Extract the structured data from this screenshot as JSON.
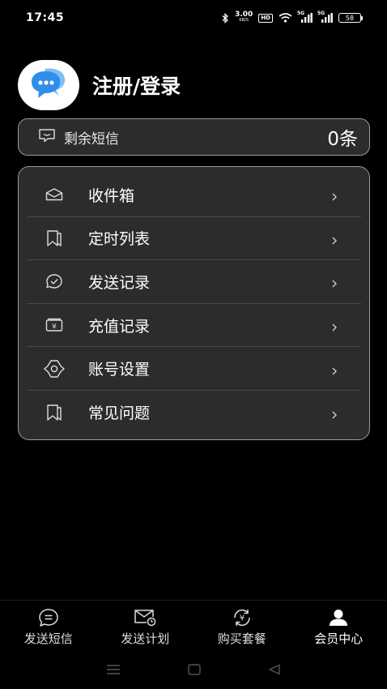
{
  "status_bar": {
    "time": "17:45",
    "net_speed_value": "3.00",
    "net_speed_unit": "KB/S",
    "hd_label": "HD",
    "sim1_tag": "5G",
    "sim2_tag": "5G",
    "battery_level": "58"
  },
  "profile": {
    "name": "注册/登录",
    "avatar_icon": "chat-bubbles-icon"
  },
  "balance": {
    "label": "剩余短信",
    "value": "0条",
    "icon": "message-icon"
  },
  "menu": {
    "items": [
      {
        "label": "收件箱",
        "icon": "inbox-icon"
      },
      {
        "label": "定时列表",
        "icon": "bookmark-icon"
      },
      {
        "label": "发送记录",
        "icon": "sent-check-icon"
      },
      {
        "label": "充值记录",
        "icon": "wallet-yen-icon"
      },
      {
        "label": "账号设置",
        "icon": "gear-icon"
      },
      {
        "label": "常见问题",
        "icon": "bookmark-icon"
      }
    ]
  },
  "bottom_nav": {
    "items": [
      {
        "label": "发送短信",
        "icon": "chat-icon"
      },
      {
        "label": "发送计划",
        "icon": "mail-clock-icon"
      },
      {
        "label": "购买套餐",
        "icon": "yen-refresh-icon"
      },
      {
        "label": "会员中心",
        "icon": "user-icon",
        "active": true
      }
    ]
  },
  "colors": {
    "background": "#000000",
    "card": "#2c2c2c",
    "card_border": "#9a9a9a",
    "avatar_blue": "#2f8ee8"
  }
}
